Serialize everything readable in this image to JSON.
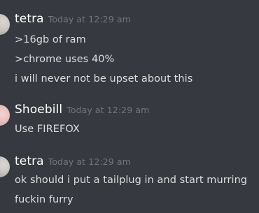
{
  "messages": [
    {
      "username": "tetra",
      "timestamp": "Today at 12:29 am",
      "lines": [
        ">16gb of ram",
        ">chrome uses 40%",
        "i will never not be upset about this"
      ]
    },
    {
      "username": "Shoebill",
      "timestamp": "Today at 12:29 am",
      "lines": [
        "Use FIREFOX"
      ]
    },
    {
      "username": "tetra",
      "timestamp": "Today at 12:29 am",
      "lines": [
        "ok should i put a tailplug in and start murring",
        "fuckin furry"
      ]
    }
  ],
  "colors": {
    "background": "#36393f",
    "username": "#ffffff",
    "timestamp": "#72767d",
    "message_text": "#dcddde"
  },
  "icons": {
    "avatar_tetra": "user-avatar",
    "avatar_shoebill": "user-avatar"
  }
}
